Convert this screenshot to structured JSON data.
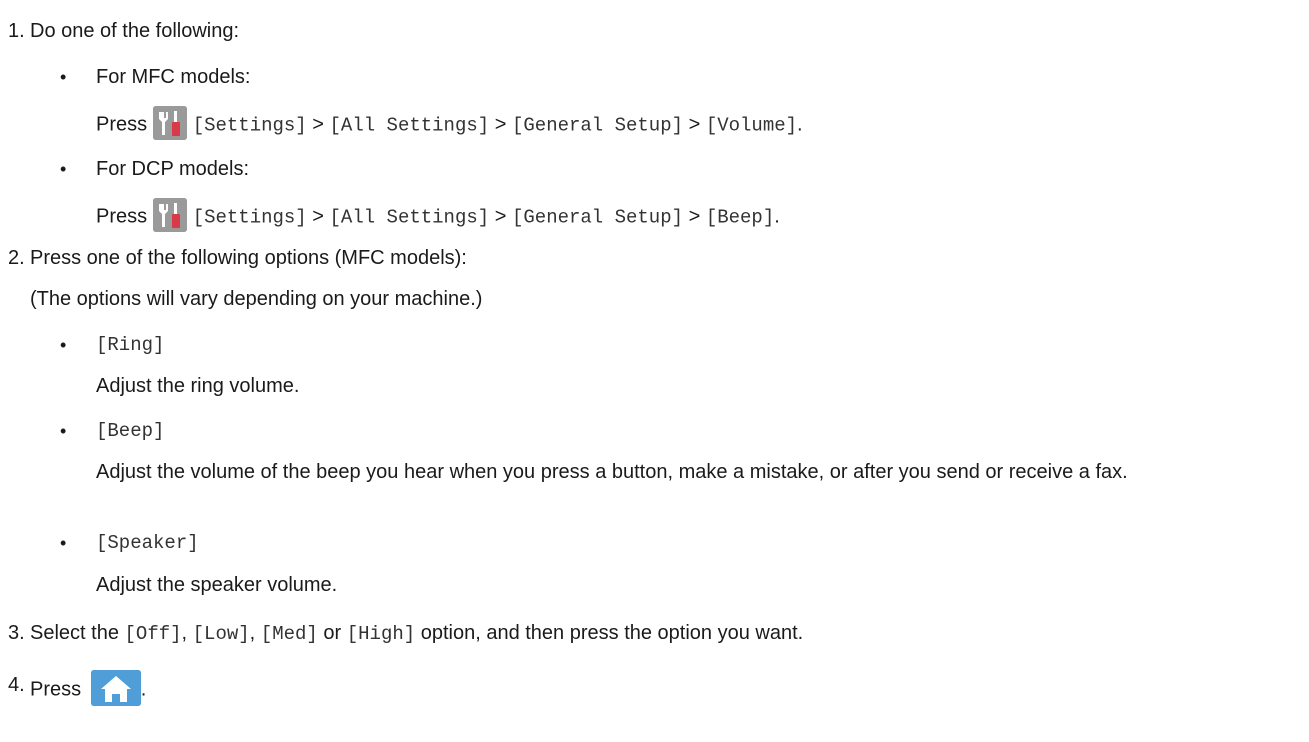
{
  "steps": [
    {
      "num": "1.",
      "text": "Do one of the following:"
    },
    {
      "num": "2.",
      "text": "Press one of the following options (MFC models):",
      "note": "(The options will vary depending on your machine.)"
    },
    {
      "num": "3."
    },
    {
      "num": "4.",
      "text": "Press"
    }
  ],
  "step1": {
    "mfc_heading": "For MFC models:",
    "dcp_heading": "For DCP models:",
    "press": "Press",
    "settings": "[Settings]",
    "all_settings": "[All Settings]",
    "general_setup": "[General Setup]",
    "volume": "[Volume]",
    "beep": "[Beep]",
    "separator": ">",
    "period": "."
  },
  "step2": {
    "options": [
      {
        "label": "[Ring]",
        "desc": "Adjust the ring volume."
      },
      {
        "label": "[Beep]",
        "desc": "Adjust the volume of the beep you hear when you press a button, make a mistake, or after you send or receive a fax."
      },
      {
        "label": "[Speaker]",
        "desc": "Adjust the speaker volume."
      }
    ]
  },
  "step3": {
    "pre": "Select the",
    "off": "[Off]",
    "comma": ",",
    "low": "[Low]",
    "med": "[Med]",
    "or": "or",
    "high": "[High]",
    "post": "option, and then press the option you want."
  },
  "step4": {
    "period": "."
  },
  "bullet": "•",
  "icons": {
    "settings": "settings-icon",
    "home": "home-icon"
  },
  "colors": {
    "settings_gray": "#9a9a9a",
    "wrench_red": "#d83a47",
    "home_blue": "#4f9ed8"
  }
}
